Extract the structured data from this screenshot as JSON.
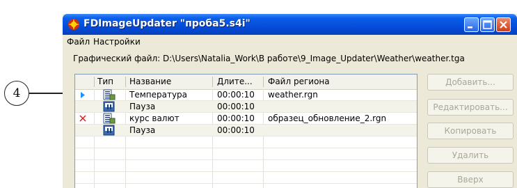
{
  "callout": {
    "number": "4"
  },
  "window": {
    "title": "FDImageUpdater \"проба5.s4i\"",
    "menu": [
      "Файл",
      "Настройки"
    ],
    "file_label": "Графический файл: D:\\Users\\Natalia_Work\\В работе\\9_Image_Updater\\Weather\\weather.tga"
  },
  "table": {
    "columns": [
      "Тип",
      "Название",
      "Длите...",
      "Файл региона"
    ],
    "rows": [
      {
        "marker": "play-arrow-icon",
        "type_icon": "data-page-icon",
        "name": "Температура",
        "duration": "00:00:10",
        "region_file": "weather.rgn"
      },
      {
        "marker": "",
        "type_icon": "pause-page-icon",
        "name": "Пауза",
        "duration": "00:00:10",
        "region_file": ""
      },
      {
        "marker": "error-x-icon",
        "type_icon": "data-page-icon",
        "name": "курс валют",
        "duration": "00:00:10",
        "region_file": "образец_обновление_2.rgn"
      },
      {
        "marker": "",
        "type_icon": "pause-page-icon",
        "name": "Пауза",
        "duration": "00:00:10",
        "region_file": ""
      }
    ]
  },
  "buttons": {
    "add": "Добавить...",
    "edit": "Редактировать...",
    "copy": "Копировать",
    "delete": "Удалить",
    "up": "Вверх"
  },
  "colors": {
    "titlebar": "#0449d6",
    "marker_arrow": "#1e90ff",
    "marker_x": "#d22020",
    "button_text_disabled": "#a9a799"
  }
}
